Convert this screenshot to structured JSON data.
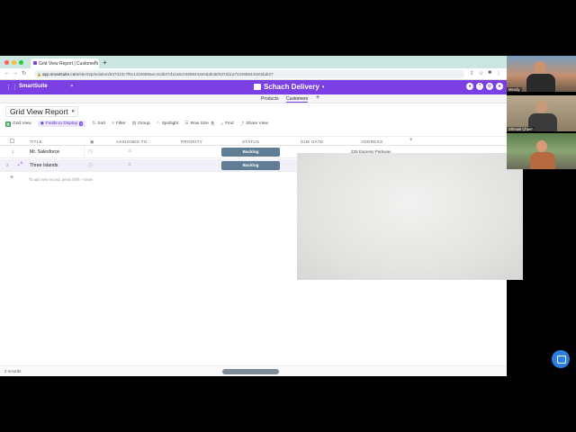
{
  "browser": {
    "tab_title": "Grid View Report | Customers",
    "new_tab": "+",
    "url_host": "app.smartsuite.com",
    "url_path": "/s5e32p/solution/637d10c7f6c1410689aec4cd637d11a5c04696442e0dab48/637d11a7c04696442e0dab47",
    "dot_colors": [
      "#ff5f57",
      "#febc2e",
      "#28c840"
    ]
  },
  "app": {
    "brand": "SmartSuite",
    "workspace_title": "Schach Delivery",
    "accent_color": "#7b3fe4"
  },
  "subnav": {
    "items": [
      "Products",
      "Customers"
    ],
    "active": "Customers",
    "add": "+"
  },
  "view": {
    "title": "Grid View Report"
  },
  "toolbar": {
    "grid_view": "Grid View",
    "fields": "Fields to Display",
    "fields_count": "9",
    "sort": "Sort",
    "filter": "Filter",
    "group": "Group",
    "spotlight": "Spotlight",
    "row_size": "Row Size",
    "row_size_value": "5",
    "find": "Find",
    "share_view": "Share View"
  },
  "grid": {
    "columns": [
      "TITLE",
      "ASSIGNED TO",
      "PRIORITY",
      "STATUS",
      "DUE DATE",
      "ADDRESS"
    ],
    "add_column": "+",
    "rows": [
      {
        "num": "1",
        "title": "Mr. Salesforce",
        "status": "Backlog",
        "address": "235 Express Parkway"
      },
      {
        "num": "2",
        "title": "Three Islands",
        "status": "Backlog",
        "address": ""
      }
    ],
    "add_hint": "To add new record, press Shift + Enter",
    "add_plus": "+"
  },
  "footer": {
    "records": "2 records"
  },
  "participants": [
    "Mendy",
    "Shmuel Chaim",
    ""
  ]
}
